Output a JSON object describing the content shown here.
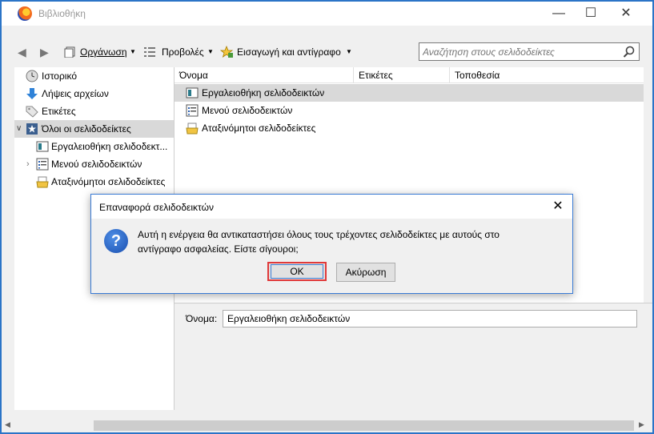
{
  "window": {
    "title": "Βιβλιοθήκη"
  },
  "toolbar": {
    "organize": "Οργάνωση",
    "views": "Προβολές",
    "import": "Εισαγωγή και αντίγραφο",
    "search_placeholder": "Αναζήτηση στους σελιδοδείκτες"
  },
  "sidebar": {
    "items": [
      {
        "label": "Ιστορικό",
        "icon": "clock-icon"
      },
      {
        "label": "Λήψεις αρχείων",
        "icon": "download-icon"
      },
      {
        "label": "Ετικέτες",
        "icon": "tag-icon"
      },
      {
        "label": "Όλοι οι σελιδοδείκτες",
        "icon": "star-icon"
      },
      {
        "label": "Εργαλειοθήκη σελιδοδεκτ...",
        "icon": "toolbar-icon"
      },
      {
        "label": "Μενού σελιδοδεικτών",
        "icon": "menu-icon"
      },
      {
        "label": "Αταξινόμητοι σελιδοδείκτες",
        "icon": "unsorted-icon"
      }
    ]
  },
  "table": {
    "columns": [
      "Όνομα",
      "Ετικέτες",
      "Τοποθεσία"
    ],
    "rows": [
      {
        "name": "Εργαλειοθήκη σελιδοδεικτών"
      },
      {
        "name": "Μενού σελιδοδεικτών"
      },
      {
        "name": "Αταξινόμητοι σελιδοδείκτες"
      }
    ]
  },
  "details": {
    "name_label": "Όνομα:",
    "name_value": "Εργαλειοθήκη σελιδοδεικτών"
  },
  "dialog": {
    "title": "Επαναφορά σελιδοδεικτών",
    "message_line1": "Αυτή η ενέργεια θα αντικαταστήσει όλους τους τρέχοντες σελιδοδείκτες με αυτούς στο",
    "message_line2": "αντίγραφο ασφαλείας. Είστε σίγουροι;",
    "ok_label": "OK",
    "cancel_label": "Ακύρωση"
  },
  "colors": {
    "accent": "#2b74c7",
    "selection": "#d9d9d9",
    "highlight": "#e0393a"
  }
}
